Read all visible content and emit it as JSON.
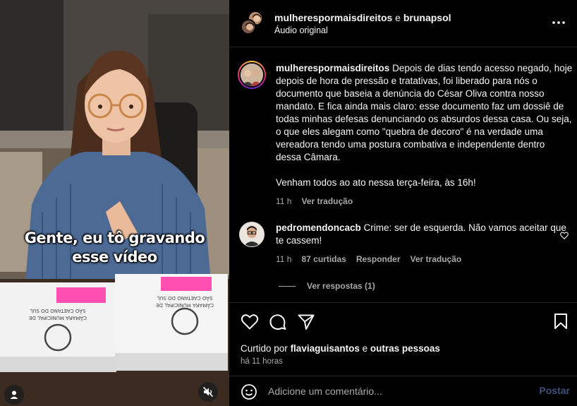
{
  "video": {
    "caption_lines": [
      "Gente, eu tô gravando",
      "esse vídeo"
    ],
    "document_text": "CÂMARA MUNICIPAL DE SÃO CAETANO DO SUL",
    "icons": {
      "profile": "user-icon",
      "mute": "speaker-muted-icon"
    }
  },
  "header": {
    "user1": "mulherespormaisdireitos",
    "conjunction": "e",
    "user2": "brunapsol",
    "audio": "Áudio original",
    "more_icon": "more-horizontal-icon"
  },
  "caption": {
    "user": "mulherespormaisdireitos",
    "text": "Depois de dias tendo acesso negado, hoje depois de hora de pressão e tratativas, foi liberado para nós o documento que baseia a denúncia do César Oliva contra nosso mandato. E fica ainda mais claro: esse documento faz um dossiê de todas minhas defesas denunciando os absurdos dessa casa. Ou seja, o que eles alegam como \"quebra de decoro\" é na verdade uma vereadora tendo uma postura combativa e independente dentro dessa Câmara.",
    "text2": "Venham todos ao ato nessa terça-feira, às 16h!",
    "time": "11 h",
    "translate": "Ver tradução"
  },
  "comment": {
    "user": "pedromendoncacb",
    "text": "Crime: ser de esquerda. Não vamos aceitar que te cassem!",
    "time": "11 h",
    "likes": "87 curtidas",
    "reply": "Responder",
    "translate": "Ver tradução",
    "view_replies": "Ver respostas (1)"
  },
  "actions": {
    "liked_prefix": "Curtido por",
    "liked_user": "flaviaguisantos",
    "liked_and": "e",
    "liked_others": "outras pessoas",
    "time": "há 11 horas"
  },
  "add_comment": {
    "placeholder": "Adicione um comentário...",
    "post_label": "Postar"
  },
  "colors": {
    "background": "#000000",
    "muted_text": "#a8a8a8",
    "post_button": "#3d4f7a",
    "caption_highlight": "#ff4fb0"
  }
}
